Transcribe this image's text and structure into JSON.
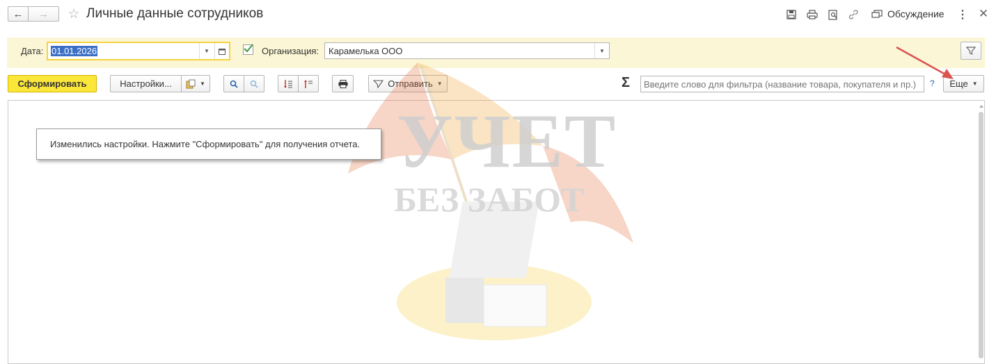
{
  "window": {
    "title": "Личные данные сотрудников",
    "discussion_label": "Обсуждение"
  },
  "filters": {
    "date_label": "Дата:",
    "date_value": "01.01.2026",
    "org_checked": true,
    "org_label": "Организация:",
    "org_value": "Карамелька ООО"
  },
  "toolbar": {
    "generate_label": "Сформировать",
    "settings_label": "Настройки...",
    "send_label": "Отправить",
    "search_placeholder": "Введите слово для фильтра (название товара, покупателя и пр.)",
    "help_label": "?",
    "more_label": "Еще",
    "sigma_label": "Σ"
  },
  "report": {
    "notice": "Изменились настройки. Нажмите \"Сформировать\" для получения отчета."
  },
  "watermark": {
    "line1": "УЧЕТ",
    "line2": "БЕЗ ЗАБОТ"
  },
  "colors": {
    "accent_yellow": "#fbe63a",
    "filter_panel_bg": "#fbf6d5",
    "annotation_arrow": "#d9534f",
    "check_green": "#3f9b3f"
  }
}
